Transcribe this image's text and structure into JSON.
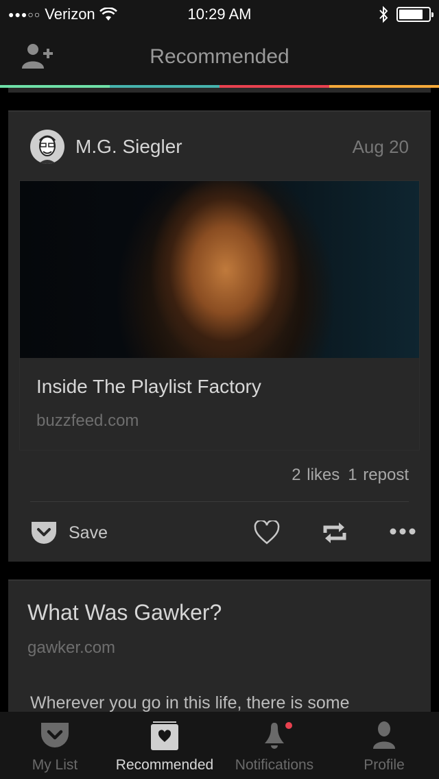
{
  "status_bar": {
    "signal": "●●●○○",
    "carrier": "Verizon",
    "time": "10:29 AM",
    "wifi_icon": "wifi-icon",
    "bluetooth_icon": "bluetooth-icon",
    "battery_level": 0.8
  },
  "nav": {
    "title": "Recommended",
    "left_icon": "add-user-icon"
  },
  "accent_colors": [
    "#6fe0a8",
    "#46b3ad",
    "#e8414f",
    "#f5a93a"
  ],
  "feed": {
    "post": {
      "author": "M.G. Siegler",
      "date": "Aug 20",
      "article_title": "Inside The Playlist Factory",
      "article_domain": "buzzfeed.com",
      "likes": "2 likes",
      "reposts": "1 repost",
      "save_label": "Save"
    },
    "next_post": {
      "title": "What Was Gawker?",
      "domain": "gawker.com",
      "excerpt": "Wherever you go in this life, there is some"
    }
  },
  "tabs": [
    {
      "label": "My List",
      "icon": "pocket-icon",
      "active": false
    },
    {
      "label": "Recommended",
      "icon": "recommended-icon",
      "active": true
    },
    {
      "label": "Notifications",
      "icon": "bell-icon",
      "active": false,
      "badge_color": "#e8414f"
    },
    {
      "label": "Profile",
      "icon": "profile-icon",
      "active": false
    }
  ]
}
